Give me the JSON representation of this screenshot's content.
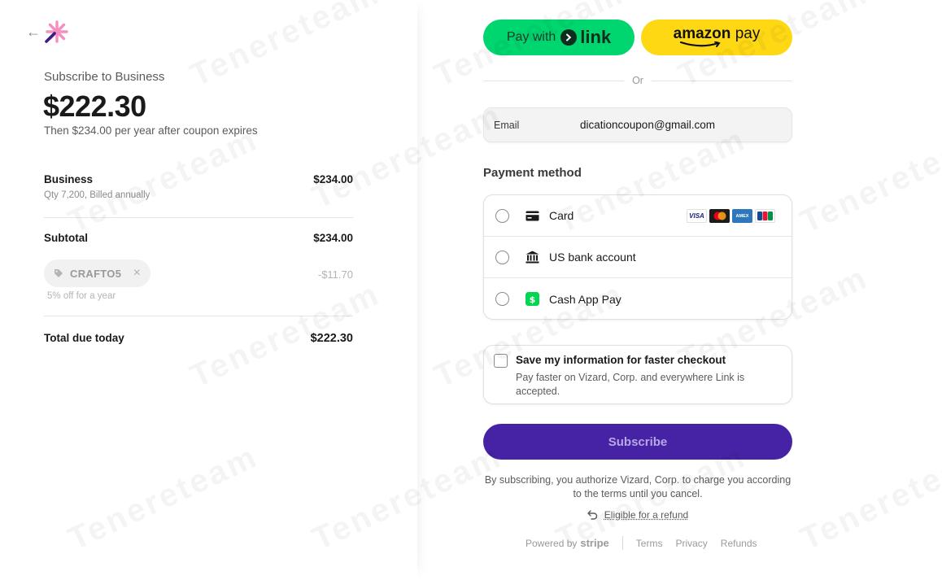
{
  "summary": {
    "back_icon": "arrow-left-icon",
    "logo_icon": "sparkle-logo-icon",
    "subscribe_to": "Subscribe to Business",
    "price": "$222.30",
    "then_text": "Then $234.00 per year after coupon expires",
    "line_item": {
      "name": "Business",
      "qty": "Qty 7,200, Billed annually",
      "amount": "$234.00"
    },
    "subtotal_label": "Subtotal",
    "subtotal_amount": "$234.00",
    "coupon": {
      "code": "CRAFTO5",
      "amount": "-$11.70",
      "description": "5% off for a year"
    },
    "total_label": "Total due today",
    "total_amount": "$222.30"
  },
  "express": {
    "link_prefix": "Pay with",
    "link_word": "link",
    "amazon_word": "amazon",
    "amazon_pay": "pay",
    "link_color": "#00d66f",
    "amazon_color": "#ffd814"
  },
  "or_text": "Or",
  "email": {
    "label": "Email",
    "value": "dicationcoupon@gmail.com"
  },
  "payment": {
    "title": "Payment method",
    "methods": [
      {
        "label": "Card",
        "icon": "card-icon"
      },
      {
        "label": "US bank account",
        "icon": "bank-icon"
      },
      {
        "label": "Cash App Pay",
        "icon": "cashapp-icon"
      }
    ],
    "brands": [
      "VISA",
      "mastercard",
      "AMEX",
      "JCB"
    ]
  },
  "save_info": {
    "title": "Save my information for faster checkout",
    "description": "Pay faster on Vizard, Corp. and everywhere Link is accepted."
  },
  "subscribe_button": "Subscribe",
  "subscribe_color": "#4523a4",
  "terms": "By subscribing, you authorize Vizard, Corp. to charge you according to the terms until you cancel.",
  "refund_link": "Eligible for a refund",
  "footer": {
    "powered_by": "Powered by",
    "stripe": "stripe",
    "links": [
      "Terms",
      "Privacy",
      "Refunds"
    ]
  },
  "watermark_text": "Tenereteam"
}
